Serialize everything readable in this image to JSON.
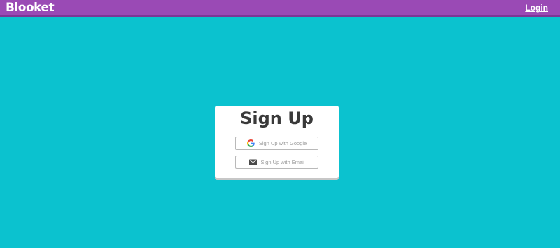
{
  "header": {
    "brand": "Blooket",
    "login_label": "Login"
  },
  "signup": {
    "title": "Sign Up",
    "google_label": "Sign Up with Google",
    "email_label": "Sign Up with Email",
    "google_icon": "google-g-icon",
    "email_icon": "envelope-icon"
  },
  "colors": {
    "background": "#0bc2cf",
    "header": "#9a4ab5",
    "card": "#ffffff",
    "title_text": "#3a3a3a",
    "button_text": "#9a9a9a"
  }
}
